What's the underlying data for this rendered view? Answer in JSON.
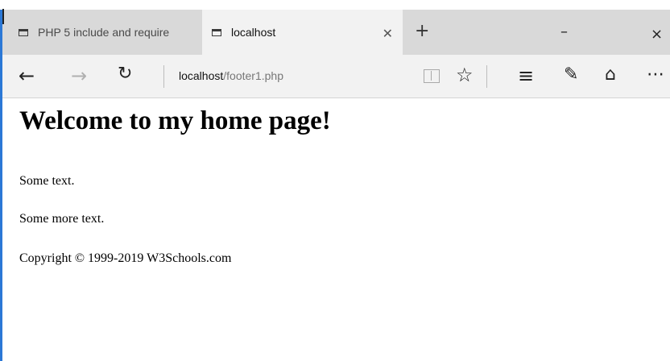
{
  "tabs": [
    {
      "title": "PHP 5 include and require",
      "active": false
    },
    {
      "title": "localhost",
      "active": true
    }
  ],
  "new_tab_label": "+",
  "window_controls": {
    "minimize": "–",
    "maximize": "□",
    "close": "×"
  },
  "nav": {
    "back_icon": "back-arrow-icon",
    "forward_icon": "forward-arrow-icon",
    "refresh_icon": "refresh-icon",
    "address_host": "localhost",
    "address_path": "/footer1.php"
  },
  "toolbar_icons": [
    "reading-view-icon",
    "favorite-star-icon",
    "hub-icon",
    "web-note-icon",
    "share-icon",
    "more-icon"
  ],
  "page": {
    "heading": "Welcome to my home page!",
    "paragraphs": [
      "Some text.",
      "Some more text."
    ],
    "footer": "Copyright © 1999-2019 W3Schools.com"
  },
  "colors": {
    "tabstrip": "#d9d9d9",
    "active_tab": "#f2f2f2",
    "window_border": "#2b78d6"
  }
}
